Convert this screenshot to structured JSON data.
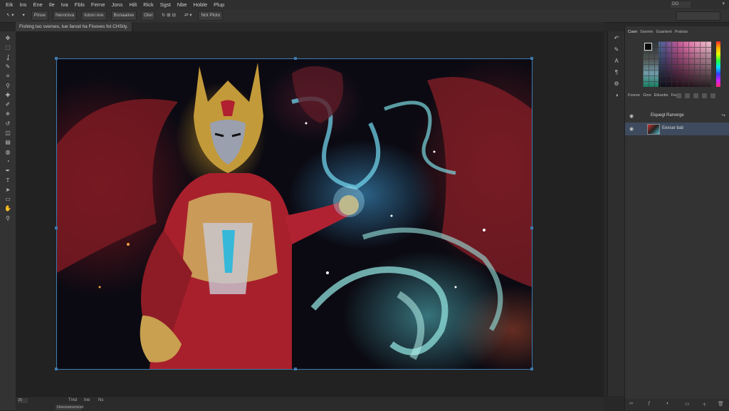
{
  "menu": [
    "Eik",
    "Ins",
    "Ene",
    "Ile",
    "Iva",
    "Fbls",
    "Ferne",
    "Jons",
    "Hilt",
    "Rick",
    "Sgst",
    "Nbe",
    "Hoble",
    "Plup"
  ],
  "options_bar": {
    "items": [
      "Pinse",
      "Neroniva",
      "Iotoni Are",
      "Bonaaiive",
      "Otel",
      "Nnt Ploto"
    ],
    "icons": [
      "arrow-icon",
      "dropdown-icon",
      "grid-icon",
      "align-icon",
      "rotate-icon",
      "transform-icon",
      "distribute-icon"
    ]
  },
  "search_text": "DO",
  "document_tab": "Fishing tuo sverses, tue fanod ha Flooves fot CHSiIy.",
  "status_bar": {
    "zoom": "25",
    "tabs": [
      "Tmd",
      "Ine",
      "Ns"
    ],
    "doc_info": "Hoessarurnesd"
  },
  "panels": {
    "top_tabs": [
      "Coon",
      "Swomn",
      "Guanient",
      "Praloss"
    ],
    "mid_tabs": [
      "Fosree",
      "Gino",
      "Etkanite",
      "Feal"
    ],
    "layers": [
      {
        "name": "Eiquegt Rarverge",
        "selected": false
      },
      {
        "name": "Eexsar tiab",
        "selected": true
      }
    ]
  },
  "tool_icons": [
    "move-tool-icon",
    "marquee-tool-icon",
    "lasso-tool-icon",
    "quick-select-icon",
    "crop-tool-icon",
    "eyedropper-icon",
    "healing-brush-icon",
    "brush-tool-icon",
    "clone-stamp-icon",
    "history-brush-icon",
    "eraser-tool-icon",
    "gradient-tool-icon",
    "blur-tool-icon",
    "dodge-tool-icon",
    "pen-tool-icon",
    "type-tool-icon",
    "path-select-icon",
    "shape-tool-icon",
    "hand-tool-icon",
    "zoom-tool-icon"
  ],
  "right_strip_icons": [
    "history-icon",
    "brush-settings-icon",
    "character-icon",
    "paragraph-icon",
    "properties-icon",
    "adjustments-icon"
  ]
}
